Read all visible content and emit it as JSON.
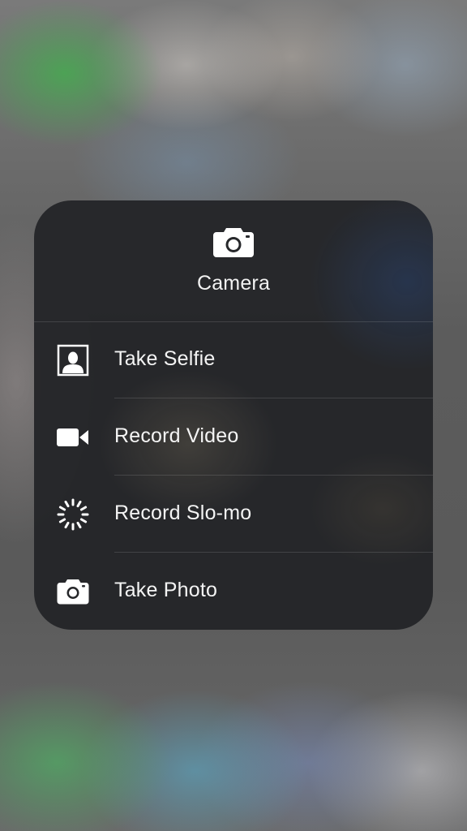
{
  "quick_actions": {
    "app_name": "Camera",
    "app_icon": "camera-icon",
    "items": [
      {
        "label": "Take Selfie",
        "icon": "selfie-portrait-icon"
      },
      {
        "label": "Record Video",
        "icon": "video-camera-icon"
      },
      {
        "label": "Record Slo-mo",
        "icon": "slomo-icon"
      },
      {
        "label": "Take Photo",
        "icon": "camera-icon"
      }
    ]
  }
}
